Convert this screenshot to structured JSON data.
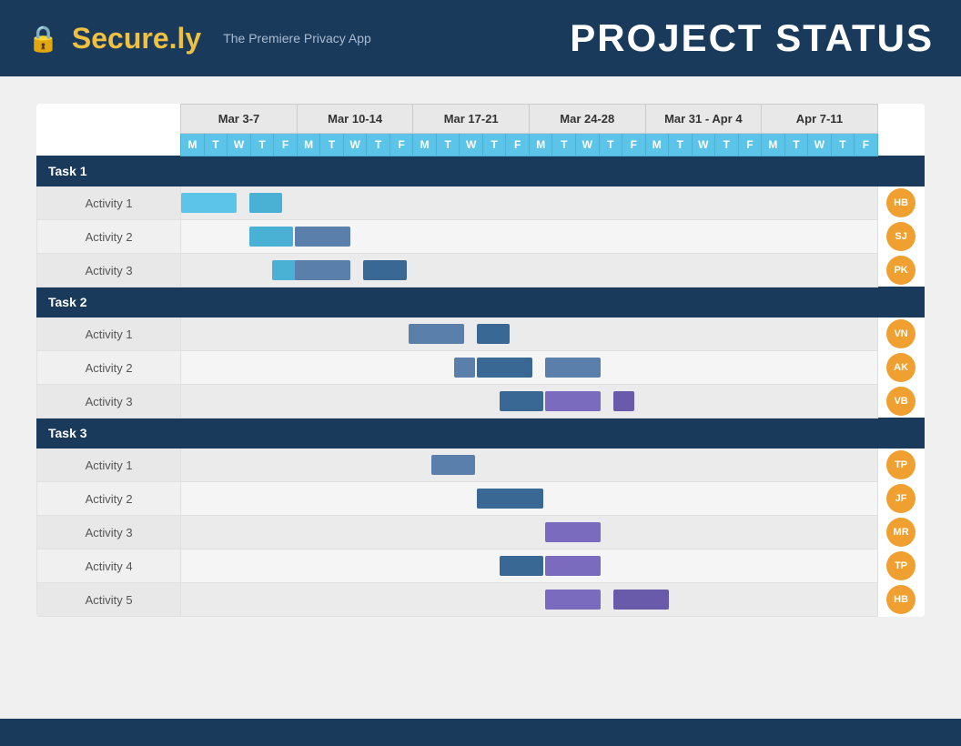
{
  "header": {
    "logo_icon": "🔒",
    "logo_name": "Secure.",
    "logo_suffix": "ly",
    "tagline": "The Premiere Privacy App",
    "project_title": "PROJECT STATUS"
  },
  "weeks": [
    {
      "label": "Mar 3-7",
      "days": [
        "M",
        "T",
        "W",
        "T",
        "F"
      ]
    },
    {
      "label": "Mar 10-14",
      "days": [
        "M",
        "T",
        "W",
        "T",
        "F"
      ]
    },
    {
      "label": "Mar 17-21",
      "days": [
        "M",
        "T",
        "W",
        "T",
        "F"
      ]
    },
    {
      "label": "Mar 24-28",
      "days": [
        "M",
        "T",
        "W",
        "T",
        "F"
      ]
    },
    {
      "label": "Mar 31 - Apr 4",
      "days": [
        "M",
        "T",
        "W",
        "T",
        "F"
      ]
    },
    {
      "label": "Apr 7-11",
      "days": [
        "M",
        "T",
        "W",
        "T",
        "F"
      ]
    }
  ],
  "tasks": [
    {
      "label": "Task 1",
      "activities": [
        {
          "label": "Activity 1",
          "avatar": "HB",
          "bars": [
            {
              "start": 0,
              "width": 2.5,
              "color": "light-blue"
            },
            {
              "start": 3,
              "width": 1.5,
              "color": "medium-blue"
            }
          ]
        },
        {
          "label": "Activity 2",
          "avatar": "SJ",
          "bars": [
            {
              "start": 3,
              "width": 2,
              "color": "medium-blue"
            },
            {
              "start": 5,
              "width": 2.5,
              "color": "steel-blue"
            }
          ]
        },
        {
          "label": "Activity 3",
          "avatar": "PK",
          "bars": [
            {
              "start": 4,
              "width": 1.5,
              "color": "medium-blue"
            },
            {
              "start": 5,
              "width": 2.5,
              "color": "steel-blue"
            },
            {
              "start": 8,
              "width": 2,
              "color": "dark-blue"
            }
          ]
        }
      ]
    },
    {
      "label": "Task 2",
      "activities": [
        {
          "label": "Activity 1",
          "avatar": "VN",
          "bars": [
            {
              "start": 10,
              "width": 2.5,
              "color": "steel-blue"
            },
            {
              "start": 13,
              "width": 1.5,
              "color": "dark-blue"
            }
          ]
        },
        {
          "label": "Activity 2",
          "avatar": "AK",
          "bars": [
            {
              "start": 12,
              "width": 1,
              "color": "steel-blue"
            },
            {
              "start": 13,
              "width": 2.5,
              "color": "dark-blue"
            },
            {
              "start": 16,
              "width": 2.5,
              "color": "steel-blue"
            }
          ]
        },
        {
          "label": "Activity 3",
          "avatar": "VB",
          "bars": [
            {
              "start": 14,
              "width": 2,
              "color": "dark-blue"
            },
            {
              "start": 16,
              "width": 2.5,
              "color": "purple"
            },
            {
              "start": 19,
              "width": 1,
              "color": "medium-purple"
            }
          ]
        }
      ]
    },
    {
      "label": "Task 3",
      "activities": [
        {
          "label": "Activity 1",
          "avatar": "TP",
          "bars": [
            {
              "start": 11,
              "width": 2,
              "color": "steel-blue"
            }
          ]
        },
        {
          "label": "Activity 2",
          "avatar": "JF",
          "bars": [
            {
              "start": 13,
              "width": 3,
              "color": "dark-blue"
            }
          ]
        },
        {
          "label": "Activity 3",
          "avatar": "MR",
          "bars": [
            {
              "start": 16,
              "width": 2.5,
              "color": "purple"
            }
          ]
        },
        {
          "label": "Activity 4",
          "avatar": "TP",
          "bars": [
            {
              "start": 14,
              "width": 2,
              "color": "dark-blue"
            },
            {
              "start": 16,
              "width": 2.5,
              "color": "purple"
            }
          ]
        },
        {
          "label": "Activity 5",
          "avatar": "HB",
          "bars": [
            {
              "start": 16,
              "width": 2.5,
              "color": "purple"
            },
            {
              "start": 19,
              "width": 2.5,
              "color": "medium-purple"
            }
          ]
        }
      ]
    }
  ],
  "bar_colors": {
    "light-blue": "#5bc4e8",
    "medium-blue": "#4ab0d4",
    "steel-blue": "#5a7faa",
    "dark-blue": "#3a6894",
    "purple": "#7b6bbf",
    "medium-purple": "#6a5aaa"
  }
}
